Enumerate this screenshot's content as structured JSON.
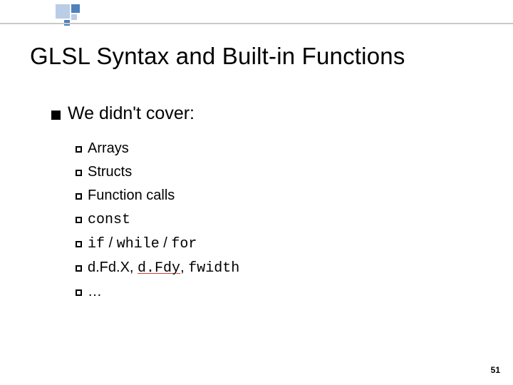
{
  "slide": {
    "title": "GLSL Syntax and Built-in Functions",
    "heading": "We didn't cover:",
    "items": {
      "arrays": "Arrays",
      "structs": "Structs",
      "funccalls": "Function calls",
      "const": "const",
      "if": "if",
      "sep": " / ",
      "while": "while",
      "for": "for",
      "dfdx_a": "d.Fd.X",
      "comma": ", ",
      "dfdy": "d.Fdy",
      "fwidth": "fwidth",
      "ellipsis": "…"
    },
    "page": "51"
  }
}
